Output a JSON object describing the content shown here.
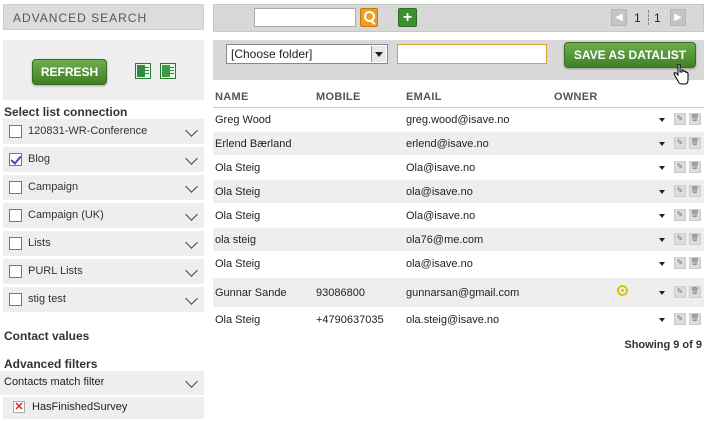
{
  "sidebar": {
    "header": "ADVANCED SEARCH",
    "refresh_label": "REFRESH",
    "excel_icon": "excel-export-icon",
    "csv_icon": "csv-export-icon",
    "list_connection_title": "Select list connection",
    "connections": [
      {
        "label": "120831-WR-Conference",
        "checked": false
      },
      {
        "label": "Blog",
        "checked": true
      },
      {
        "label": "Campaign",
        "checked": false
      },
      {
        "label": "Campaign (UK)",
        "checked": false
      },
      {
        "label": "Lists",
        "checked": false
      },
      {
        "label": "PURL Lists",
        "checked": false
      },
      {
        "label": "stig test",
        "checked": false
      }
    ],
    "contact_values_title": "Contact values",
    "advanced_filters_title": "Advanced filters",
    "match_filter_label": "Contacts match filter",
    "filters": [
      "HasFinishedSurvey"
    ]
  },
  "toolbar": {
    "search_value": "",
    "add_label": "+",
    "pager": {
      "current": "1",
      "total": "1",
      "prev": "◀",
      "next": "▶"
    }
  },
  "folder_bar": {
    "folder_select_value": "[Choose folder]",
    "datalist_name_value": "",
    "save_label": "SAVE AS DATALIST"
  },
  "table": {
    "columns": [
      "NAME",
      "MOBILE",
      "EMAIL",
      "OWNER"
    ],
    "rows": [
      {
        "name": "Greg Wood",
        "mobile": "",
        "email": "greg.wood@isave.no",
        "owner_icon": false
      },
      {
        "name": "Erlend Bærland",
        "mobile": "",
        "email": "erlend@isave.no",
        "owner_icon": false
      },
      {
        "name": "Ola Steig",
        "mobile": "",
        "email": "Ola@isave.no",
        "owner_icon": false
      },
      {
        "name": "Ola Steig",
        "mobile": "",
        "email": "ola@isave.no",
        "owner_icon": false
      },
      {
        "name": "Ola Steig",
        "mobile": "",
        "email": "Ola@isave.no",
        "owner_icon": false
      },
      {
        "name": "ola steig",
        "mobile": "",
        "email": "ola76@me.com",
        "owner_icon": false
      },
      {
        "name": "Ola Steig",
        "mobile": "",
        "email": "ola@isave.no",
        "owner_icon": false
      },
      {
        "name": "Gunnar Sande",
        "mobile": "93086800",
        "email": "gunnarsan@gmail.com",
        "owner_icon": true
      },
      {
        "name": "Ola Steig",
        "mobile": "+4790637035",
        "email": "ola.steig@isave.no",
        "owner_icon": false
      }
    ],
    "showing_text": "Showing 9 of 9"
  },
  "colors": {
    "button_green": "#4e9234",
    "search_orange": "#f0a020",
    "panel_gray": "#eeeeee",
    "header_gray": "#d8d8d8",
    "owner_yellow": "#d4c800"
  }
}
